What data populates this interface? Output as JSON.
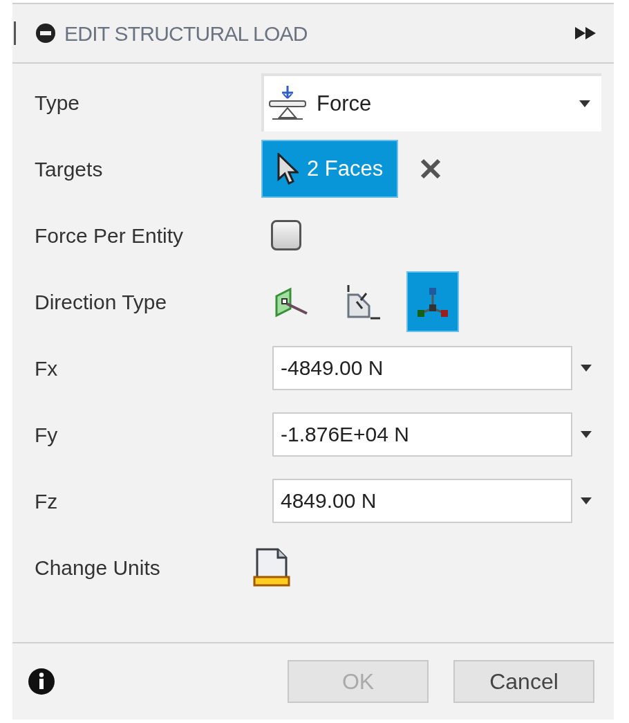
{
  "panel": {
    "title": "EDIT STRUCTURAL LOAD"
  },
  "rows": [
    {
      "kind": "dropdown",
      "label": "Type",
      "value": "Force"
    },
    {
      "kind": "selection",
      "label": "Targets",
      "value": "2 Faces",
      "selected": true
    },
    {
      "kind": "checkbox",
      "label": "Force Per Entity",
      "checked": false
    },
    {
      "kind": "direction",
      "label": "Direction Type",
      "options": [
        {
          "selected": false
        },
        {
          "selected": false
        },
        {
          "selected": true
        }
      ]
    },
    {
      "kind": "input",
      "label": "Fx",
      "value": "-4849.00 N"
    },
    {
      "kind": "input",
      "label": "Fy",
      "value": "-1.876E+04 N"
    },
    {
      "kind": "input",
      "label": "Fz",
      "value": "4849.00 N"
    },
    {
      "kind": "units",
      "label": "Change Units"
    }
  ],
  "buttons": [
    {
      "label": "OK",
      "disabled": true
    },
    {
      "label": "Cancel",
      "disabled": false
    }
  ]
}
